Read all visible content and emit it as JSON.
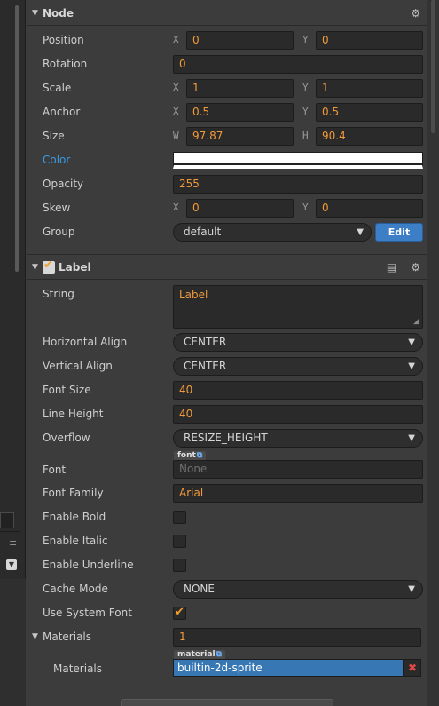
{
  "node": {
    "title": "Node",
    "position": {
      "label": "Position",
      "x_axis": "X",
      "x": "0",
      "y_axis": "Y",
      "y": "0"
    },
    "rotation": {
      "label": "Rotation",
      "value": "0"
    },
    "scale": {
      "label": "Scale",
      "x_axis": "X",
      "x": "1",
      "y_axis": "Y",
      "y": "1"
    },
    "anchor": {
      "label": "Anchor",
      "x_axis": "X",
      "x": "0.5",
      "y_axis": "Y",
      "y": "0.5"
    },
    "size": {
      "label": "Size",
      "w_axis": "W",
      "w": "97.87",
      "h_axis": "H",
      "h": "90.4"
    },
    "color": {
      "label": "Color",
      "value": "#ffffff"
    },
    "opacity": {
      "label": "Opacity",
      "value": "255"
    },
    "skew": {
      "label": "Skew",
      "x_axis": "X",
      "x": "0",
      "y_axis": "Y",
      "y": "0"
    },
    "group": {
      "label": "Group",
      "value": "default",
      "edit_label": "Edit"
    }
  },
  "label": {
    "title": "Label",
    "enabled": true,
    "string": {
      "label": "String",
      "value": "Label"
    },
    "horizontal_align": {
      "label": "Horizontal Align",
      "value": "CENTER"
    },
    "vertical_align": {
      "label": "Vertical Align",
      "value": "CENTER"
    },
    "font_size": {
      "label": "Font Size",
      "value": "40"
    },
    "line_height": {
      "label": "Line Height",
      "value": "40"
    },
    "overflow": {
      "label": "Overflow",
      "value": "RESIZE_HEIGHT"
    },
    "font": {
      "label": "Font",
      "tag": "font",
      "placeholder": "None"
    },
    "font_family": {
      "label": "Font Family",
      "value": "Arial"
    },
    "enable_bold": {
      "label": "Enable Bold",
      "checked": false
    },
    "enable_italic": {
      "label": "Enable Italic",
      "checked": false
    },
    "enable_underline": {
      "label": "Enable Underline",
      "checked": false
    },
    "cache_mode": {
      "label": "Cache Mode",
      "value": "NONE"
    },
    "use_system_font": {
      "label": "Use System Font",
      "checked": true
    },
    "materials": {
      "label": "Materials",
      "count": "1"
    },
    "material_item": {
      "label": "Materials",
      "tag": "material",
      "value": "builtin-2d-sprite"
    }
  },
  "colors": {
    "accent_orange": "#f09a3a",
    "link_blue": "#3a9ae0",
    "edit_button": "#3d7fc7",
    "material_blue": "#3777b4"
  }
}
